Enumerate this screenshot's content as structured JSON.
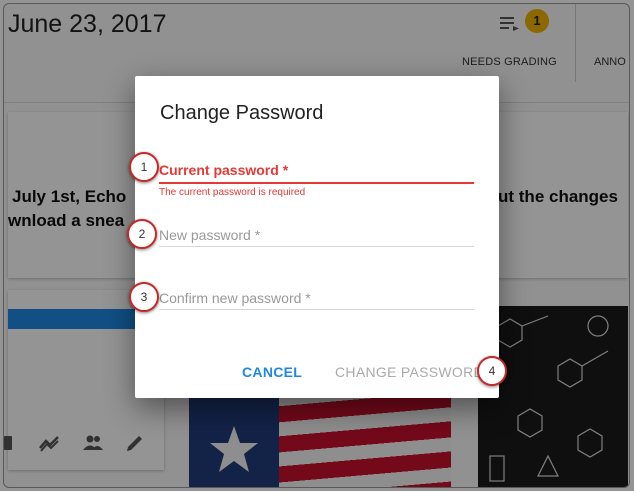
{
  "background": {
    "date": "June 23, 2017",
    "badge_count": "1",
    "needs_grading": "NEEDS GRADING",
    "annou_fragment": "ANNO",
    "text_line1": "July 1st, Echo",
    "text_line2": "wnload a snea",
    "text_right": "ut the changes"
  },
  "dialog": {
    "title": "Change Password",
    "fields": [
      {
        "label": "Current password *",
        "error": "The current password is required"
      },
      {
        "label": "New password *"
      },
      {
        "label": "Confirm new password *"
      }
    ],
    "cancel_label": "CANCEL",
    "change_label": "CHANGE PASSWORD"
  },
  "steps": [
    "1",
    "2",
    "3",
    "4"
  ],
  "colors": {
    "error": "#e53935",
    "accent": "#1e88e5",
    "badge": "#f2b400",
    "step_border": "#c62828"
  }
}
